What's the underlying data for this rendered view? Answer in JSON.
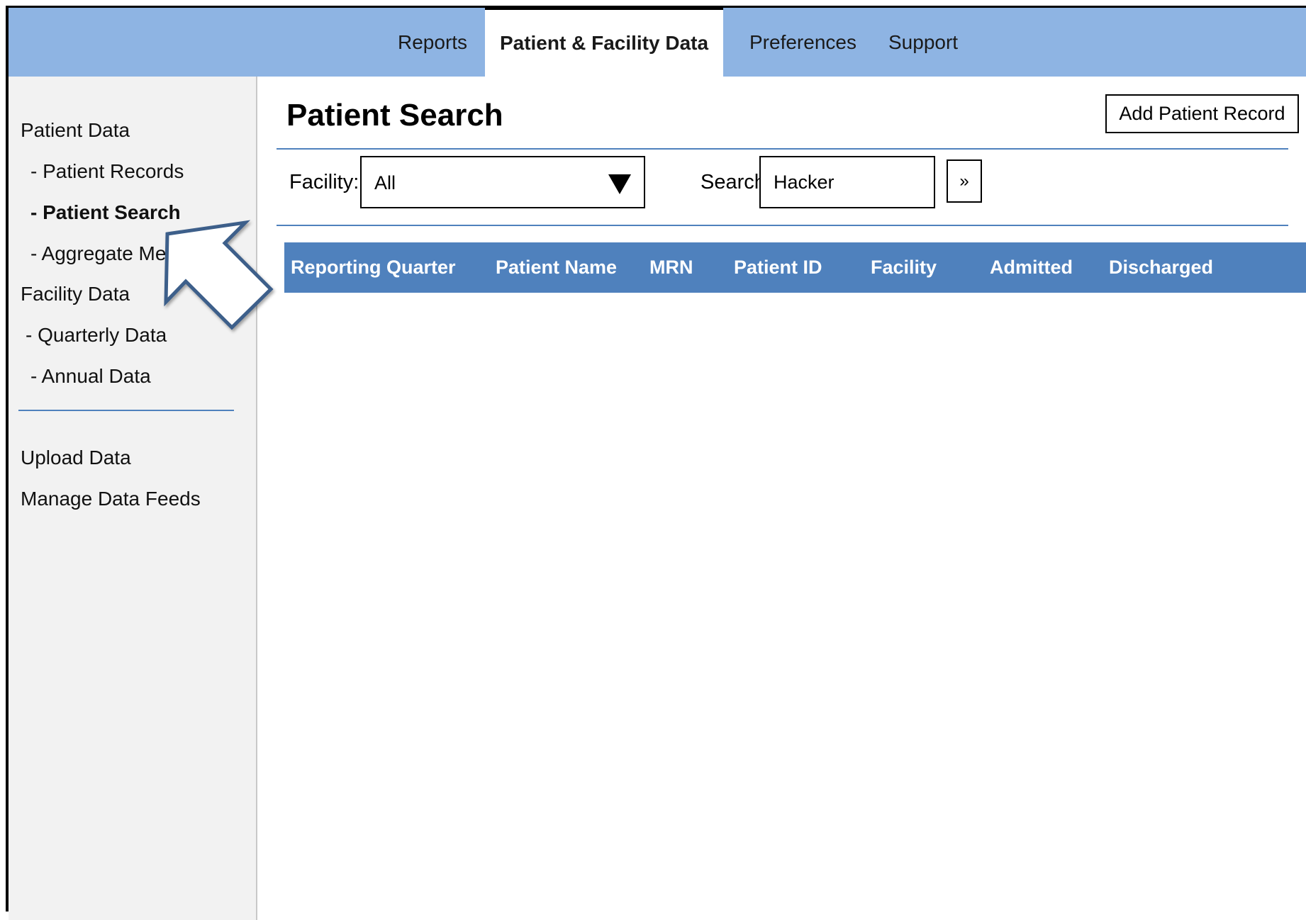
{
  "topnav": {
    "tabs": [
      {
        "label": "Reports"
      },
      {
        "label": "Patient & Facility Data",
        "active": true
      },
      {
        "label": "Preferences"
      },
      {
        "label": "Support"
      }
    ]
  },
  "sidebar": {
    "items": [
      {
        "label": "Patient Data"
      },
      {
        "label": "- Patient Records"
      },
      {
        "label": "- Patient Search",
        "selected": true
      },
      {
        "label": "- Aggregate Me"
      },
      {
        "label": "Facility Data"
      },
      {
        "label": "- Quarterly Data"
      },
      {
        "label": "- Annual Data"
      },
      {
        "label": "Upload Data"
      },
      {
        "label": "Manage Data Feeds"
      }
    ]
  },
  "main": {
    "title": "Patient Search",
    "add_button_label": "Add Patient Record",
    "facility_label": "Facility:",
    "facility_value": "All",
    "search_label": "Search:",
    "search_value": "Hacker",
    "go_button_label": "»",
    "table": {
      "columns": [
        "Reporting Quarter",
        "Patient Name",
        "MRN",
        "Patient ID",
        "Facility",
        "Admitted",
        "Discharged"
      ],
      "rows": []
    }
  },
  "colors": {
    "topbar": "#8eb4e3",
    "table_header": "#4f81bd",
    "sidebar_bg": "#f2f2f2",
    "rule": "#4f81bd",
    "arrow_stroke": "#3d5f8a"
  },
  "icons": {
    "dropdown": "chevron-down-icon",
    "pointer": "pointer-arrow-icon"
  }
}
